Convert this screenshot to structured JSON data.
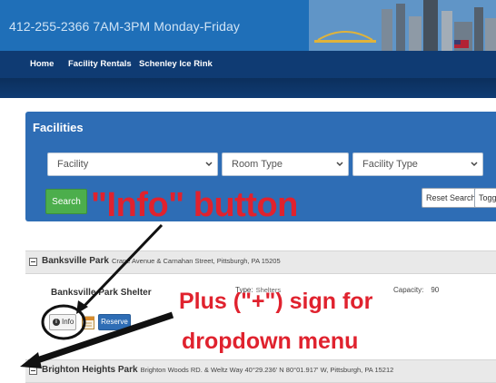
{
  "header": {
    "contact_text": "412-255-2366    7AM-3PM Monday-Friday"
  },
  "nav": {
    "items": [
      {
        "label": "Home"
      },
      {
        "label": "Facility Rentals"
      },
      {
        "label": "Schenley Ice Rink"
      }
    ]
  },
  "facilities": {
    "title": "Facilities",
    "dropdowns": [
      {
        "selected": "Facility"
      },
      {
        "selected": "Room Type"
      },
      {
        "selected": "Facility Type"
      }
    ],
    "search_label": "Search",
    "reset_label": "Reset Search",
    "toggle_label": "Toggle"
  },
  "parks": [
    {
      "name": "Banksville Park",
      "address": "Crane Avenue & Carnahan Street, Pittsburgh, PA 15205"
    },
    {
      "name": "Brighton Heights Park",
      "address": "Brighton Woods RD. & Weltz Way 40°29.236' N 80°01.917' W, Pittsburgh, PA 15212"
    }
  ],
  "shelter": {
    "name": "Banksville Park Shelter",
    "type_label": "Type:",
    "type_value": "Shelters",
    "capacity_label": "Capacity:",
    "capacity_value": "90",
    "info_label": "Info",
    "reserve_label": "Reserve"
  },
  "annotations": {
    "info_note": "\"Info\" button",
    "plus_note": "Plus (\"+\") sign for",
    "menu_note": "dropdown menu",
    "color": "#e0222e"
  },
  "icons": {
    "info": "info-circle-icon",
    "calendar": "calendar-icon",
    "chevron": "chevron-down-icon",
    "expand": "minus-square-icon"
  }
}
